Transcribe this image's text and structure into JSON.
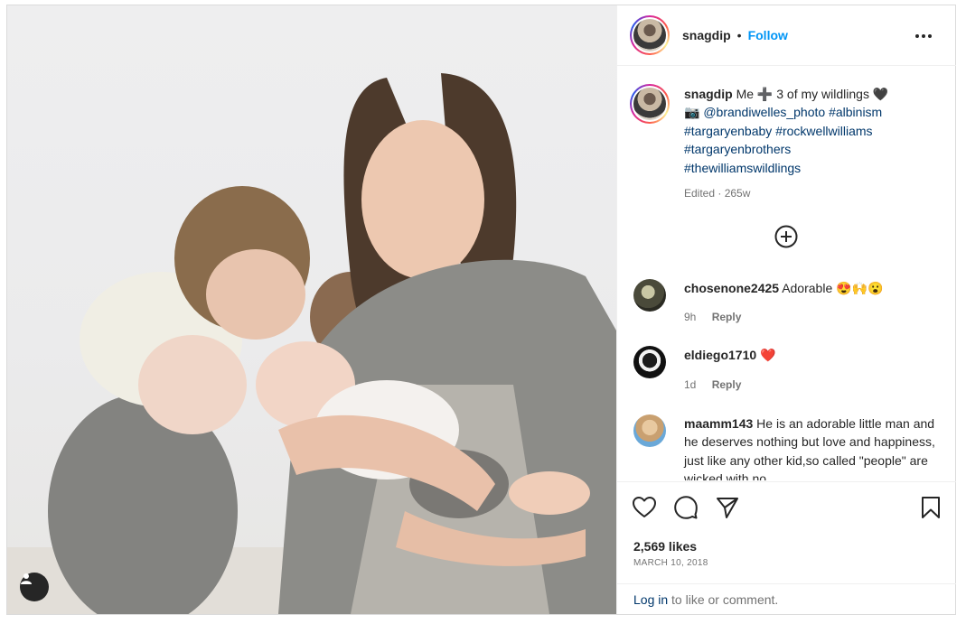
{
  "post": {
    "username": "snagdip",
    "separator": "•",
    "follow_label": "Follow",
    "caption": {
      "text_before": "Me",
      "plus_emoji": "➕",
      "text_after": "3 of my wildlings",
      "heart_emoji": "🖤",
      "camera_emoji": "📷",
      "mention": "@brandiwelles_photo",
      "hashtags": [
        "#albinism",
        "#targaryenbaby",
        "#rockwellwilliams",
        "#targaryenbrothers",
        "#thewilliamswildlings"
      ]
    },
    "caption_meta": "Edited · 265w"
  },
  "comments": [
    {
      "username": "chosenone2425",
      "text": "Adorable",
      "emojis": "😍🙌😮",
      "time": "9h",
      "reply_label": "Reply"
    },
    {
      "username": "eldiego1710",
      "text": "",
      "emojis": "❤️",
      "time": "1d",
      "reply_label": "Reply"
    },
    {
      "username": "maamm143",
      "text": "He is an adorable little man and he deserves nothing but love and happiness, just like any other kid,so called \"people\" are wicked with no",
      "emojis": ""
    }
  ],
  "engagement": {
    "likes": "2,569 likes",
    "date": "MARCH 10, 2018"
  },
  "footer": {
    "login_link": "Log in",
    "login_rest": " to like or comment."
  },
  "icons": {
    "options": "more-options-icon",
    "add_comment": "plus-circle-icon",
    "like": "heart-icon",
    "comment": "comment-icon",
    "share": "share-icon",
    "save": "bookmark-icon",
    "tagged": "user-tag-icon"
  }
}
